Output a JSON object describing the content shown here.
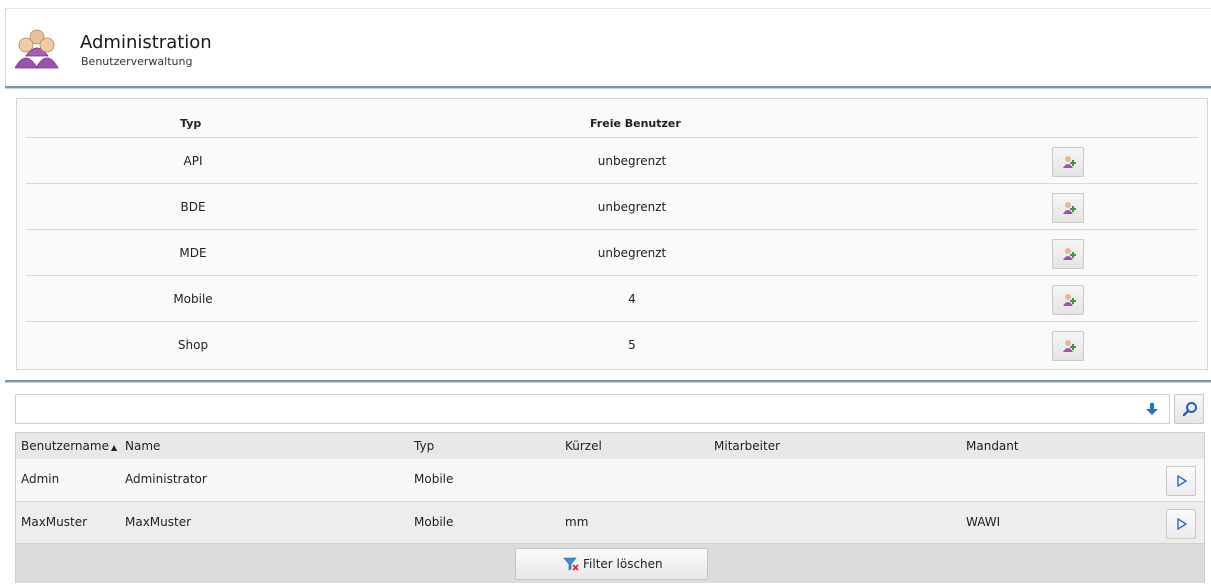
{
  "header": {
    "title": "Administration",
    "subtitle": "Benutzerverwaltung",
    "icon": "users-group-icon"
  },
  "type_table": {
    "columns": [
      "Typ",
      "Freie Benutzer"
    ],
    "rows": [
      {
        "typ": "API",
        "free": "unbegrenzt"
      },
      {
        "typ": "BDE",
        "free": "unbegrenzt"
      },
      {
        "typ": "MDE",
        "free": "unbegrenzt"
      },
      {
        "typ": "Mobile",
        "free": "4"
      },
      {
        "typ": "Shop",
        "free": "5"
      }
    ],
    "row_action_icon": "add-user-icon"
  },
  "search": {
    "value": "",
    "placeholder": "",
    "expand_icon": "arrow-down-icon",
    "button_icon": "search-icon"
  },
  "user_grid": {
    "columns": {
      "username": "Benutzername",
      "name": "Name",
      "typ": "Typ",
      "kuerzel": "Kürzel",
      "mitarbeiter": "Mitarbeiter",
      "mandant": "Mandant"
    },
    "sort_indicator": "▲",
    "rows": [
      {
        "username": "Admin",
        "name": "Administrator",
        "typ": "Mobile",
        "kuerzel": "",
        "mitarbeiter": "",
        "mandant": ""
      },
      {
        "username": "MaxMuster",
        "name": "MaxMuster",
        "typ": "Mobile",
        "kuerzel": "mm",
        "mitarbeiter": "",
        "mandant": "WAWI"
      }
    ],
    "row_action_icon": "play-icon",
    "filter_button": "Filter löschen",
    "filter_icon": "filter-clear-icon"
  },
  "colors": {
    "divider": "#7e94a8",
    "accent_blue": "#2a6fc9",
    "icon_purple": "#8b4d9c"
  }
}
